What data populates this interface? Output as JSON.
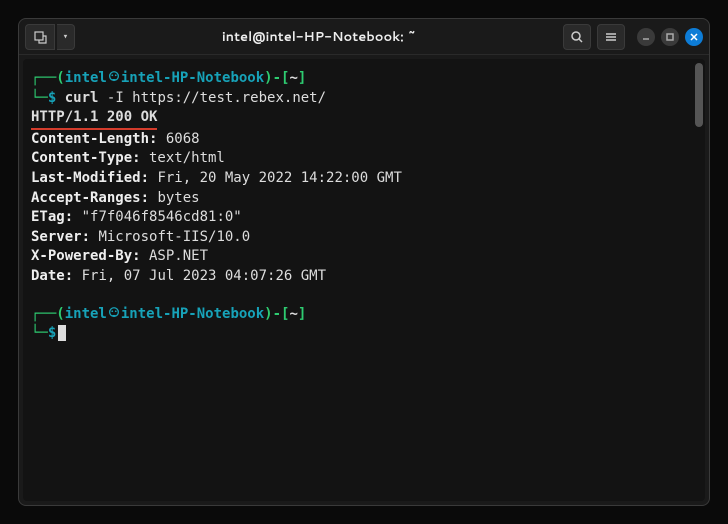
{
  "window": {
    "title": "intel@intel-HP-Notebook: ~"
  },
  "prompt": {
    "user": "intel",
    "host": "intel-HP-Notebook",
    "cwd": "~",
    "ps_dollar": "$"
  },
  "command": {
    "cmd": "curl",
    "args": "-I https://test.rebex.net/"
  },
  "response": {
    "status_line": "HTTP/1.1 200 OK",
    "headers": [
      {
        "key": "Content-Length:",
        "val": " 6068"
      },
      {
        "key": "Content-Type:",
        "val": " text/html"
      },
      {
        "key": "Last-Modified:",
        "val": " Fri, 20 May 2022 14:22:00 GMT"
      },
      {
        "key": "Accept-Ranges:",
        "val": " bytes"
      },
      {
        "key": "ETag:",
        "val": " \"f7f046f8546cd81:0\""
      },
      {
        "key": "Server:",
        "val": " Microsoft-IIS/10.0"
      },
      {
        "key": "X-Powered-By:",
        "val": " ASP.NET"
      },
      {
        "key": "Date:",
        "val": " Fri, 07 Jul 2023 04:07:26 GMT"
      }
    ]
  }
}
